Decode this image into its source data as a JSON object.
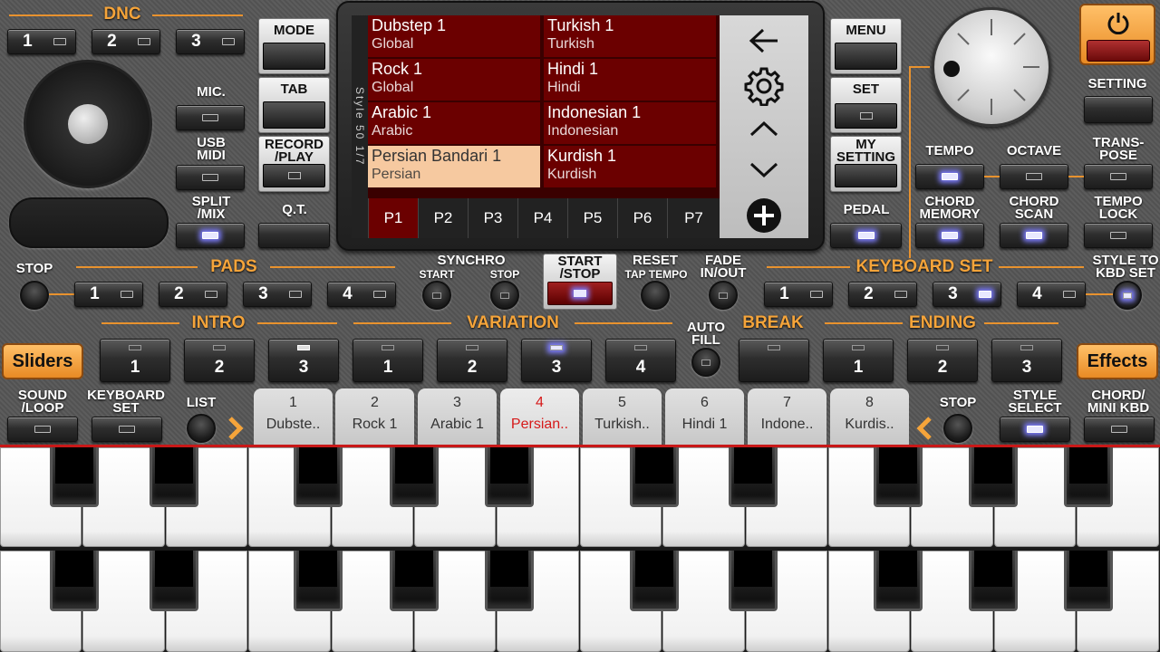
{
  "dnc": {
    "title": "DNC",
    "buttons": [
      "1",
      "2",
      "3"
    ]
  },
  "left_labels": {
    "mic": "MIC.",
    "usb_midi": "USB\nMIDI",
    "split_mix": "SPLIT\n/MIX"
  },
  "center_left": {
    "mode": "MODE",
    "tab": "TAB",
    "record_play": "RECORD\n/PLAY",
    "qt": "Q.T."
  },
  "screen": {
    "side_label": "Style 50 1/7",
    "styles": [
      {
        "name": "Dubstep 1",
        "category": "Global"
      },
      {
        "name": "Turkish 1",
        "category": "Turkish"
      },
      {
        "name": "Rock 1",
        "category": "Global"
      },
      {
        "name": "Hindi 1",
        "category": "Hindi"
      },
      {
        "name": "Arabic 1",
        "category": "Arabic"
      },
      {
        "name": "Indonesian 1",
        "category": "Indonesian"
      },
      {
        "name": "Persian Bandari 1",
        "category": "Persian"
      },
      {
        "name": "Kurdish 1",
        "category": "Kurdish"
      }
    ],
    "pages": [
      "P1",
      "P2",
      "P3",
      "P4",
      "P5",
      "P6",
      "P7"
    ],
    "selected_page": "P1"
  },
  "right_menu": {
    "menu": "MENU",
    "set": "SET",
    "my_setting": "MY\nSETTING",
    "pedal": "PEDAL"
  },
  "far_right": {
    "setting": "SETTING",
    "tempo": "TEMPO",
    "octave": "OCTAVE",
    "transpose": "TRANS-\nPOSE",
    "chord_memory": "CHORD\nMEMORY",
    "chord_scan": "CHORD\nSCAN",
    "tempo_lock": "TEMPO\nLOCK"
  },
  "row_pads": {
    "stop": "STOP",
    "pads_title": "PADS",
    "pads": [
      "1",
      "2",
      "3",
      "4"
    ],
    "synchro": "SYNCHRO",
    "synchro_start": "START",
    "synchro_stop": "STOP",
    "start_stop": "START\n/STOP",
    "reset": "RESET",
    "tap_tempo": "TAP TEMPO",
    "fade": "FADE\nIN/OUT",
    "keyboard_set_title": "KEYBOARD SET",
    "kbd_sets": [
      "1",
      "2",
      "3",
      "4"
    ],
    "style_to_kbd": "STYLE TO\nKBD SET"
  },
  "row_sections": {
    "intro_title": "INTRO",
    "intro": [
      "1",
      "2",
      "3"
    ],
    "variation_title": "VARIATION",
    "variation": [
      "1",
      "2",
      "3",
      "4"
    ],
    "auto_fill": "AUTO\nFILL",
    "break_title": "BREAK",
    "ending_title": "ENDING",
    "ending": [
      "1",
      "2",
      "3"
    ],
    "sliders": "Sliders",
    "effects": "Effects"
  },
  "row_tabs": {
    "sound_loop": "SOUND\n/LOOP",
    "keyboard_set": "KEYBOARD\nSET",
    "list": "LIST",
    "stop": "STOP",
    "style_select": "STYLE\nSELECT",
    "chord_mini_kbd": "CHORD/\nMINI KBD",
    "tabs": [
      {
        "num": "1",
        "label": "Dubste.."
      },
      {
        "num": "2",
        "label": "Rock 1"
      },
      {
        "num": "3",
        "label": "Arabic 1"
      },
      {
        "num": "4",
        "label": "Persian.."
      },
      {
        "num": "5",
        "label": "Turkish.."
      },
      {
        "num": "6",
        "label": "Hindi 1"
      },
      {
        "num": "7",
        "label": "Indone.."
      },
      {
        "num": "8",
        "label": "Kurdis.."
      }
    ],
    "selected_tab": "4"
  },
  "icons": {
    "back": "back-arrow-icon",
    "settings": "gear-icon",
    "up": "chevron-up-icon",
    "down": "chevron-down-icon",
    "add": "plus-circle-icon",
    "power": "power-icon"
  }
}
